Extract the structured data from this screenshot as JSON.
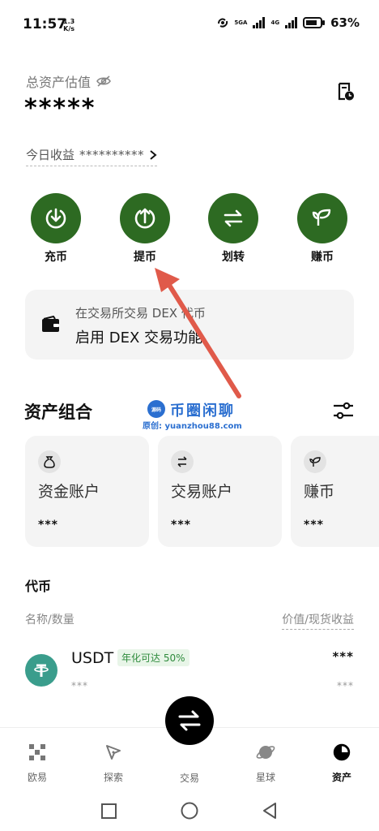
{
  "status_bar": {
    "time": "11:57",
    "speed_value": "1.3",
    "speed_unit": "K/s",
    "signal1_label": "5GA",
    "signal2_label": "4G",
    "battery": "63%"
  },
  "header": {
    "total_label": "总资产估值",
    "total_value": "*****",
    "today_label": "今日收益",
    "today_value": "**********"
  },
  "actions": [
    {
      "label": "充币"
    },
    {
      "label": "提币"
    },
    {
      "label": "划转"
    },
    {
      "label": "赚币"
    }
  ],
  "dex": {
    "line1": "在交易所交易 DEX 代币",
    "line2": "启用 DEX 交易功能"
  },
  "watermark": {
    "logo_text": "源码",
    "title": "币圈闲聊",
    "url": "原创: yuanzhou88.com"
  },
  "portfolio": {
    "title": "资产组合",
    "accounts": [
      {
        "name": "资金账户",
        "value": "***"
      },
      {
        "name": "交易账户",
        "value": "***"
      },
      {
        "name": "赚币",
        "value": "***"
      }
    ]
  },
  "tokens": {
    "title": "代币",
    "col_left": "名称/数量",
    "col_right": "价值/现货收益",
    "items": [
      {
        "symbol": "USDT",
        "badge": "年化可达 50%",
        "amount": "***",
        "value": "***",
        "pnl": "***"
      }
    ]
  },
  "bottom_nav": [
    {
      "label": "欧易"
    },
    {
      "label": "探索"
    },
    {
      "label": "交易"
    },
    {
      "label": "星球"
    },
    {
      "label": "资产"
    }
  ],
  "colors": {
    "accent_green": "#2d6a22",
    "arrow_red": "#e05a4a",
    "watermark_blue": "#2b6fd0",
    "usdt_teal": "#3a9d8c"
  }
}
